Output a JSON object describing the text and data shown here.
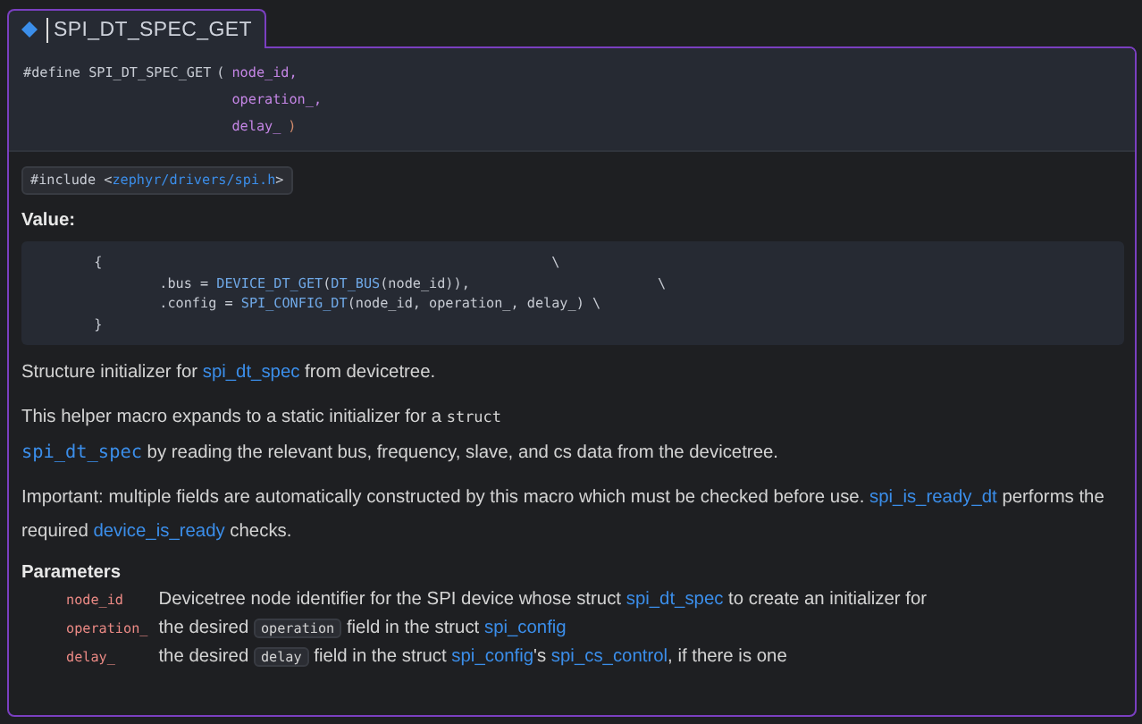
{
  "tab": {
    "label": "SPI_DT_SPEC_GET",
    "selected": true
  },
  "signature": {
    "keyword": "#define SPI_DT_SPEC_GET",
    "open": "(",
    "params": [
      "node_id,",
      "operation_,",
      "delay_"
    ],
    "close": ")"
  },
  "include": {
    "prefix": "#include <",
    "path": "zephyr/drivers/spi.h",
    "suffix": ">"
  },
  "value_heading": "Value:",
  "code_lines": [
    [
      {
        "kind": "plain",
        "text": "        {                                                       \\"
      }
    ],
    [
      {
        "kind": "plain",
        "text": "                .bus = "
      },
      {
        "kind": "fn",
        "text": "DEVICE_DT_GET"
      },
      {
        "kind": "plain",
        "text": "("
      },
      {
        "kind": "fn",
        "text": "DT_BUS"
      },
      {
        "kind": "plain",
        "text": "(node_id)),                       \\"
      }
    ],
    [
      {
        "kind": "plain",
        "text": "                .config = "
      },
      {
        "kind": "fn",
        "text": "SPI_CONFIG_DT"
      },
      {
        "kind": "plain",
        "text": "(node_id, operation_, delay_) \\"
      }
    ],
    [
      {
        "kind": "plain",
        "text": "        }"
      }
    ]
  ],
  "paragraphs": [
    [
      {
        "kind": "text",
        "text": "Structure initializer for "
      },
      {
        "kind": "link",
        "text": "spi_dt_spec"
      },
      {
        "kind": "text",
        "text": " from devicetree."
      }
    ],
    [
      {
        "kind": "text",
        "text": "This helper macro expands to a static initializer for a "
      },
      {
        "kind": "code",
        "text": "struct"
      },
      {
        "kind": "break"
      },
      {
        "kind": "codelink",
        "text": "spi_dt_spec"
      },
      {
        "kind": "text",
        "text": " by reading the relevant bus, frequency, slave, and cs data from the devicetree."
      }
    ],
    [
      {
        "kind": "text",
        "text": "Important: multiple fields are automatically constructed by this macro which must be checked before use. "
      },
      {
        "kind": "link",
        "text": "spi_is_ready_dt"
      },
      {
        "kind": "text",
        "text": " performs the required "
      },
      {
        "kind": "link",
        "text": "device_is_ready"
      },
      {
        "kind": "text",
        "text": " checks."
      }
    ]
  ],
  "parameters": {
    "heading": "Parameters",
    "items": [
      {
        "name": "node_id",
        "description": [
          {
            "kind": "text",
            "text": "Devicetree node identifier for the SPI device whose struct "
          },
          {
            "kind": "link",
            "text": "spi_dt_spec"
          },
          {
            "kind": "text",
            "text": " to create an initializer for"
          }
        ]
      },
      {
        "name": "operation_",
        "description": [
          {
            "kind": "text",
            "text": "the desired "
          },
          {
            "kind": "chip",
            "text": "operation"
          },
          {
            "kind": "text",
            "text": " field in the struct "
          },
          {
            "kind": "link",
            "text": "spi_config"
          }
        ]
      },
      {
        "name": "delay_",
        "description": [
          {
            "kind": "text",
            "text": "the desired "
          },
          {
            "kind": "chip",
            "text": "delay"
          },
          {
            "kind": "text",
            "text": " field in the struct "
          },
          {
            "kind": "link",
            "text": "spi_config"
          },
          {
            "kind": "text",
            "text": "'s "
          },
          {
            "kind": "link",
            "text": "spi_cs_control"
          },
          {
            "kind": "text",
            "text": ", if there is one"
          }
        ]
      }
    ]
  }
}
